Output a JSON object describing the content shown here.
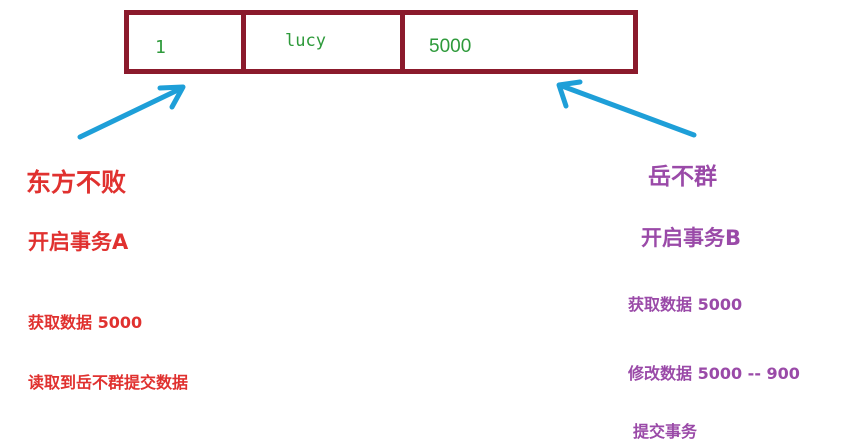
{
  "record": {
    "id": "1",
    "name": "lucy",
    "amount": "5000"
  },
  "left": {
    "actor": "东方不败",
    "step1": "开启事务A",
    "step2": "获取数据 5000",
    "step3": "读取到岳不群提交数据"
  },
  "right": {
    "actor": "岳不群",
    "step1": "开启事务B",
    "step2": "获取数据 5000",
    "step3": "修改数据 5000 -- 900",
    "step4": "提交事务"
  },
  "colors": {
    "box_border": "#8b1a2c",
    "cell_text": "#2e9a3b",
    "left_text": "#e0312f",
    "right_text": "#9a4aa8",
    "arrow": "#1e9fd8"
  }
}
